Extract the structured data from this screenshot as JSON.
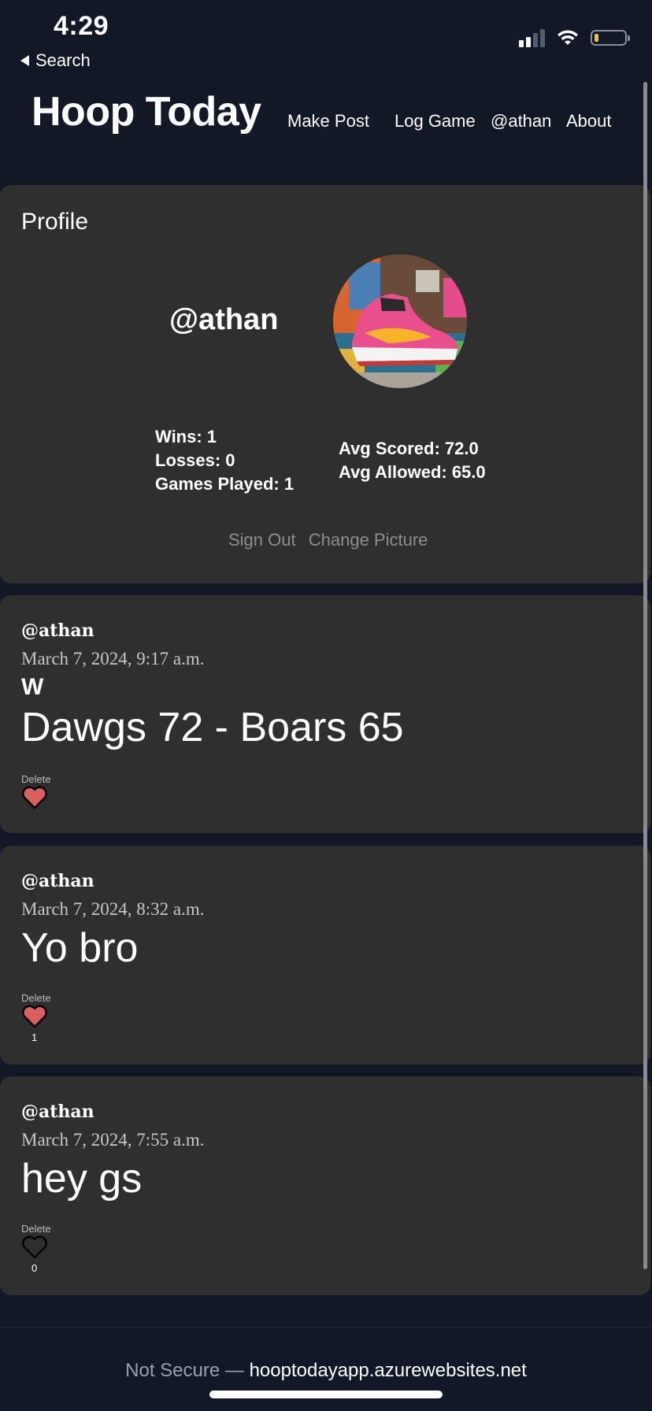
{
  "status_bar": {
    "time": "4:29",
    "back_label": "Search"
  },
  "header": {
    "brand": "Hoop Today",
    "nav": [
      "Make Post",
      "Log Game",
      "@athan",
      "About"
    ]
  },
  "profile": {
    "title": "Profile",
    "handle": "@athan",
    "avatar": "sneaker-graffiti-image",
    "stats_left": [
      "Wins: 1",
      "Losses: 0",
      "Games Played: 1"
    ],
    "stats_right": [
      "Avg Scored: 72.0",
      "Avg Allowed: 65.0"
    ],
    "actions": [
      "Sign Out",
      "Change Picture"
    ]
  },
  "posts": [
    {
      "author": "@athan",
      "timestamp": "March 7, 2024, 9:17 a.m.",
      "result": "W",
      "body": "Dawgs 72 - Boars 65",
      "delete_label": "Delete",
      "liked": true,
      "like_count": ""
    },
    {
      "author": "@athan",
      "timestamp": "March 7, 2024, 8:32 a.m.",
      "body": "Yo bro",
      "delete_label": "Delete",
      "liked": true,
      "like_count": "1"
    },
    {
      "author": "@athan",
      "timestamp": "March 7, 2024, 7:55 a.m.",
      "body": "hey gs",
      "delete_label": "Delete",
      "liked": false,
      "like_count": "0"
    }
  ],
  "url_bar": {
    "security": "Not Secure —",
    "domain": "hooptodayapp.azurewebsites.net"
  },
  "colors": {
    "background": "#121826",
    "card": "#2f2f30",
    "heart_liked": "#d9605e",
    "muted_link": "#8e8e91"
  }
}
